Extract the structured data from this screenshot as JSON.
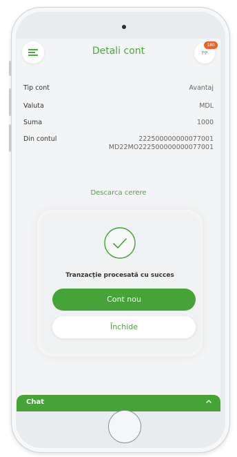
{
  "header": {
    "title": "Detali cont",
    "menu_icon": "hamburger-menu-icon",
    "avatar_initials": "PP",
    "notification_count": "180"
  },
  "account": {
    "rows": [
      {
        "label": "Tip cont",
        "value": "Avantaj"
      },
      {
        "label": "Valuta",
        "value": "MDL"
      },
      {
        "label": "Suma",
        "value": "1000"
      },
      {
        "label": "Din contul",
        "value": "222500000000077001",
        "value2": "MD22MO222500000000077001"
      }
    ]
  },
  "download_link": "Descarca cerere",
  "modal": {
    "icon": "check-circle-icon",
    "message": "Tranzacție procesată cu succes",
    "primary_button": "Cont nou",
    "secondary_button": "Închide"
  },
  "chat": {
    "label": "Chat",
    "icon": "chevron-up-icon"
  },
  "colors": {
    "accent": "#45a337",
    "badge": "#e9622b",
    "background": "#f3f4f5"
  }
}
